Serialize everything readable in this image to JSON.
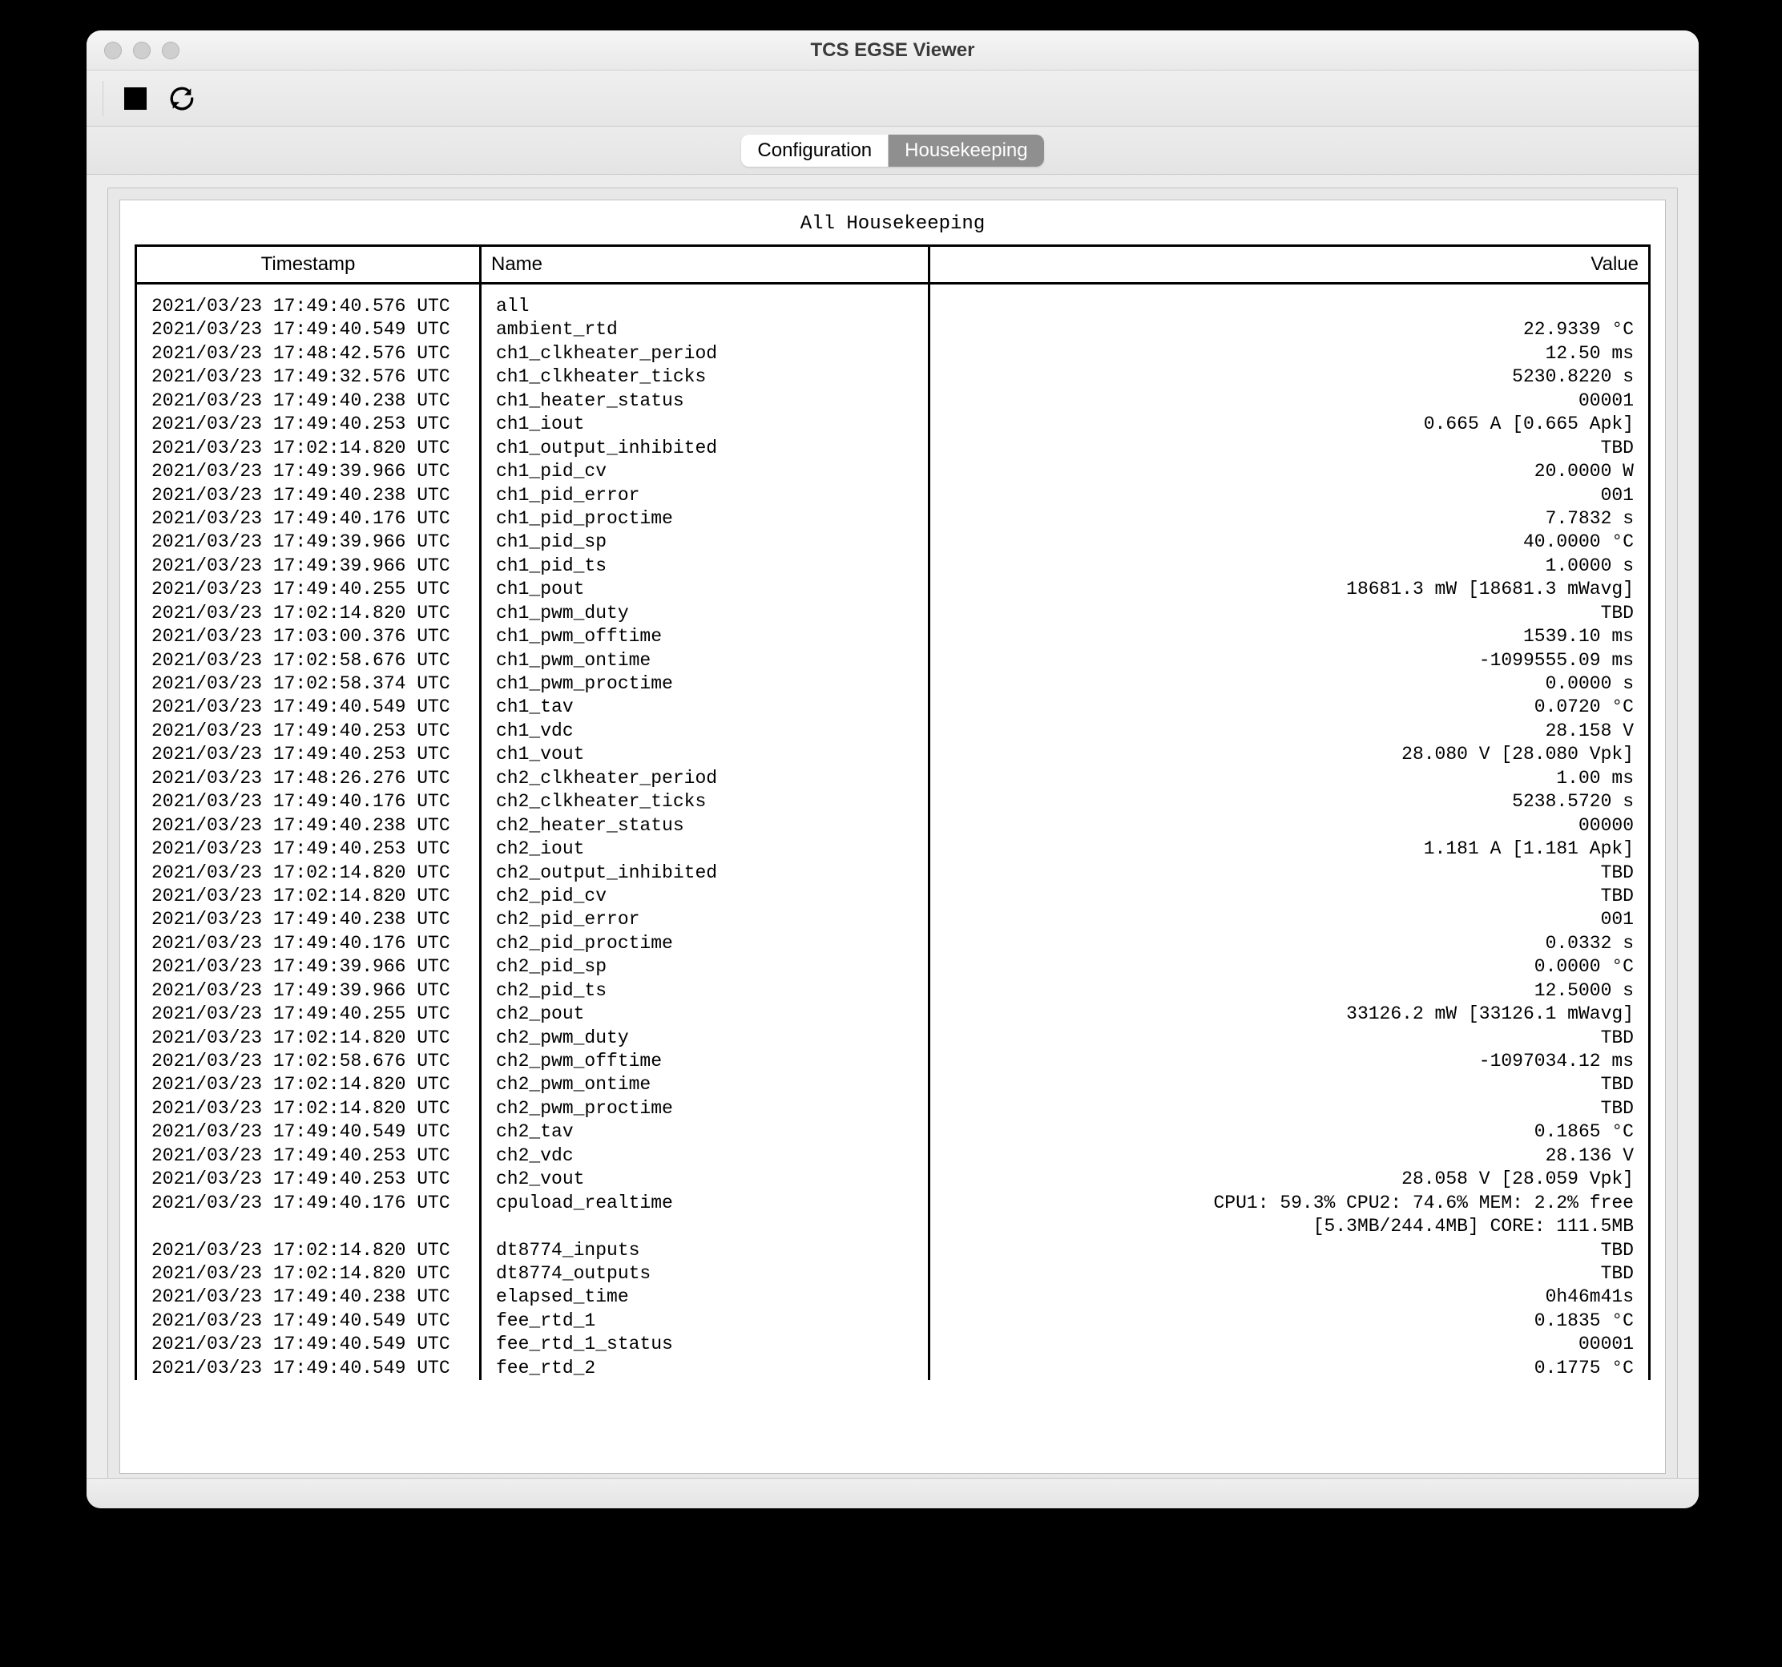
{
  "window": {
    "title": "TCS EGSE Viewer"
  },
  "tabs": {
    "configuration": "Configuration",
    "housekeeping": "Housekeeping",
    "selected": "housekeeping"
  },
  "panel": {
    "title": "All Housekeeping",
    "columns": {
      "timestamp": "Timestamp",
      "name": "Name",
      "value": "Value"
    }
  },
  "rows": [
    {
      "ts": "2021/03/23 17:49:40.576 UTC",
      "name": "all",
      "value": ""
    },
    {
      "ts": "2021/03/23 17:49:40.549 UTC",
      "name": "ambient_rtd",
      "value": "22.9339 °C"
    },
    {
      "ts": "2021/03/23 17:48:42.576 UTC",
      "name": "ch1_clkheater_period",
      "value": "12.50 ms"
    },
    {
      "ts": "2021/03/23 17:49:32.576 UTC",
      "name": "ch1_clkheater_ticks",
      "value": "5230.8220 s"
    },
    {
      "ts": "2021/03/23 17:49:40.238 UTC",
      "name": "ch1_heater_status",
      "value": "00001"
    },
    {
      "ts": "2021/03/23 17:49:40.253 UTC",
      "name": "ch1_iout",
      "value": "0.665 A [0.665 Apk]"
    },
    {
      "ts": "2021/03/23 17:02:14.820 UTC",
      "name": "ch1_output_inhibited",
      "value": "TBD"
    },
    {
      "ts": "2021/03/23 17:49:39.966 UTC",
      "name": "ch1_pid_cv",
      "value": "20.0000 W"
    },
    {
      "ts": "2021/03/23 17:49:40.238 UTC",
      "name": "ch1_pid_error",
      "value": "001"
    },
    {
      "ts": "2021/03/23 17:49:40.176 UTC",
      "name": "ch1_pid_proctime",
      "value": "7.7832 s"
    },
    {
      "ts": "2021/03/23 17:49:39.966 UTC",
      "name": "ch1_pid_sp",
      "value": "40.0000 °C"
    },
    {
      "ts": "2021/03/23 17:49:39.966 UTC",
      "name": "ch1_pid_ts",
      "value": "1.0000 s"
    },
    {
      "ts": "2021/03/23 17:49:40.255 UTC",
      "name": "ch1_pout",
      "value": "18681.3 mW [18681.3 mWavg]"
    },
    {
      "ts": "2021/03/23 17:02:14.820 UTC",
      "name": "ch1_pwm_duty",
      "value": "TBD"
    },
    {
      "ts": "2021/03/23 17:03:00.376 UTC",
      "name": "ch1_pwm_offtime",
      "value": "1539.10 ms"
    },
    {
      "ts": "2021/03/23 17:02:58.676 UTC",
      "name": "ch1_pwm_ontime",
      "value": "-1099555.09 ms"
    },
    {
      "ts": "2021/03/23 17:02:58.374 UTC",
      "name": "ch1_pwm_proctime",
      "value": "0.0000 s"
    },
    {
      "ts": "2021/03/23 17:49:40.549 UTC",
      "name": "ch1_tav",
      "value": "0.0720 °C"
    },
    {
      "ts": "2021/03/23 17:49:40.253 UTC",
      "name": "ch1_vdc",
      "value": "28.158 V"
    },
    {
      "ts": "2021/03/23 17:49:40.253 UTC",
      "name": "ch1_vout",
      "value": "28.080 V [28.080 Vpk]"
    },
    {
      "ts": "2021/03/23 17:48:26.276 UTC",
      "name": "ch2_clkheater_period",
      "value": "1.00 ms"
    },
    {
      "ts": "2021/03/23 17:49:40.176 UTC",
      "name": "ch2_clkheater_ticks",
      "value": "5238.5720 s"
    },
    {
      "ts": "2021/03/23 17:49:40.238 UTC",
      "name": "ch2_heater_status",
      "value": "00000"
    },
    {
      "ts": "2021/03/23 17:49:40.253 UTC",
      "name": "ch2_iout",
      "value": "1.181 A [1.181 Apk]"
    },
    {
      "ts": "2021/03/23 17:02:14.820 UTC",
      "name": "ch2_output_inhibited",
      "value": "TBD"
    },
    {
      "ts": "2021/03/23 17:02:14.820 UTC",
      "name": "ch2_pid_cv",
      "value": "TBD"
    },
    {
      "ts": "2021/03/23 17:49:40.238 UTC",
      "name": "ch2_pid_error",
      "value": "001"
    },
    {
      "ts": "2021/03/23 17:49:40.176 UTC",
      "name": "ch2_pid_proctime",
      "value": "0.0332 s"
    },
    {
      "ts": "2021/03/23 17:49:39.966 UTC",
      "name": "ch2_pid_sp",
      "value": "0.0000 °C"
    },
    {
      "ts": "2021/03/23 17:49:39.966 UTC",
      "name": "ch2_pid_ts",
      "value": "12.5000 s"
    },
    {
      "ts": "2021/03/23 17:49:40.255 UTC",
      "name": "ch2_pout",
      "value": "33126.2 mW [33126.1 mWavg]"
    },
    {
      "ts": "2021/03/23 17:02:14.820 UTC",
      "name": "ch2_pwm_duty",
      "value": "TBD"
    },
    {
      "ts": "2021/03/23 17:02:58.676 UTC",
      "name": "ch2_pwm_offtime",
      "value": "-1097034.12 ms"
    },
    {
      "ts": "2021/03/23 17:02:14.820 UTC",
      "name": "ch2_pwm_ontime",
      "value": "TBD"
    },
    {
      "ts": "2021/03/23 17:02:14.820 UTC",
      "name": "ch2_pwm_proctime",
      "value": "TBD"
    },
    {
      "ts": "2021/03/23 17:49:40.549 UTC",
      "name": "ch2_tav",
      "value": "0.1865 °C"
    },
    {
      "ts": "2021/03/23 17:49:40.253 UTC",
      "name": "ch2_vdc",
      "value": "28.136 V"
    },
    {
      "ts": "2021/03/23 17:49:40.253 UTC",
      "name": "ch2_vout",
      "value": "28.058 V [28.059 Vpk]"
    },
    {
      "ts": "2021/03/23 17:49:40.176 UTC",
      "name": "cpuload_realtime",
      "value": "CPU1: 59.3% CPU2: 74.6% MEM: 2.2% free"
    },
    {
      "ts": "",
      "name": "",
      "value": "[5.3MB/244.4MB] CORE: 111.5MB"
    },
    {
      "ts": "2021/03/23 17:02:14.820 UTC",
      "name": "dt8774_inputs",
      "value": "TBD"
    },
    {
      "ts": "2021/03/23 17:02:14.820 UTC",
      "name": "dt8774_outputs",
      "value": "TBD"
    },
    {
      "ts": "2021/03/23 17:49:40.238 UTC",
      "name": "elapsed_time",
      "value": "0h46m41s"
    },
    {
      "ts": "2021/03/23 17:49:40.549 UTC",
      "name": "fee_rtd_1",
      "value": "0.1835 °C"
    },
    {
      "ts": "2021/03/23 17:49:40.549 UTC",
      "name": "fee_rtd_1_status",
      "value": "00001"
    },
    {
      "ts": "2021/03/23 17:49:40.549 UTC",
      "name": "fee_rtd_2",
      "value": "0.1775 °C"
    }
  ]
}
